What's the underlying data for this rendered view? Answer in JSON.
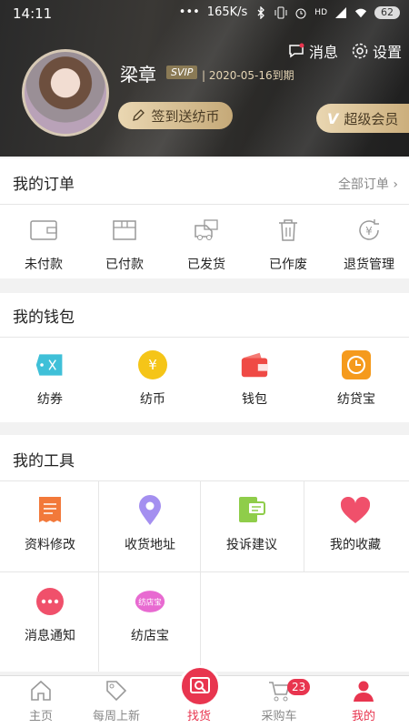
{
  "status_bar": {
    "time": "14:11",
    "dots": "•••",
    "speed": "165K/s",
    "hd": "HD",
    "battery": "62"
  },
  "header": {
    "messages_label": "消息",
    "settings_label": "设置",
    "username": "梁章",
    "svip_badge": "SVIP",
    "expire_text": "| 2020-05-16到期",
    "signin_label": "签到送纺币",
    "super_vip_label": "超级会员",
    "super_vip_letter": "V"
  },
  "orders": {
    "title": "我的订单",
    "all_label": "全部订单 ›",
    "items": [
      {
        "label": "未付款",
        "icon": "wallet-outline-icon"
      },
      {
        "label": "已付款",
        "icon": "box-outline-icon"
      },
      {
        "label": "已发货",
        "icon": "truck-outline-icon"
      },
      {
        "label": "已作废",
        "icon": "trash-outline-icon"
      },
      {
        "label": "退货管理",
        "icon": "yen-return-icon"
      }
    ]
  },
  "wallet": {
    "title": "我的钱包",
    "items": [
      {
        "label": "纺券",
        "icon": "coupon-icon",
        "color": "#3fc0d8"
      },
      {
        "label": "纺币",
        "icon": "coin-icon",
        "color": "#f5c518"
      },
      {
        "label": "钱包",
        "icon": "wallet-icon",
        "color": "#ef4a45"
      },
      {
        "label": "纺贷宝",
        "icon": "loan-icon",
        "color": "#f59a1c"
      }
    ]
  },
  "tools": {
    "title": "我的工具",
    "items": [
      {
        "label": "资料修改",
        "icon": "document-icon",
        "color": "#f2793a"
      },
      {
        "label": "收货地址",
        "icon": "location-pin-icon",
        "color": "#a48ff0"
      },
      {
        "label": "投诉建议",
        "icon": "feedback-icon",
        "color": "#8fcd4a"
      },
      {
        "label": "我的收藏",
        "icon": "heart-icon",
        "color": "#f0506b"
      },
      {
        "label": "消息通知",
        "icon": "chat-bubble-icon",
        "color": "#f0506b"
      },
      {
        "label": "纺店宝",
        "icon": "shop-badge-icon",
        "color": "#e86ad1",
        "badge_text": "纺店宝"
      }
    ]
  },
  "tabbar": {
    "items": [
      {
        "label": "主页",
        "icon": "home-icon"
      },
      {
        "label": "每周上新",
        "icon": "tag-icon"
      },
      {
        "label": "找货",
        "icon": "search-goods-icon"
      },
      {
        "label": "采购车",
        "icon": "cart-icon"
      },
      {
        "label": "我的",
        "icon": "person-icon"
      }
    ],
    "cart_count": "23",
    "accent": "#e8354f"
  }
}
